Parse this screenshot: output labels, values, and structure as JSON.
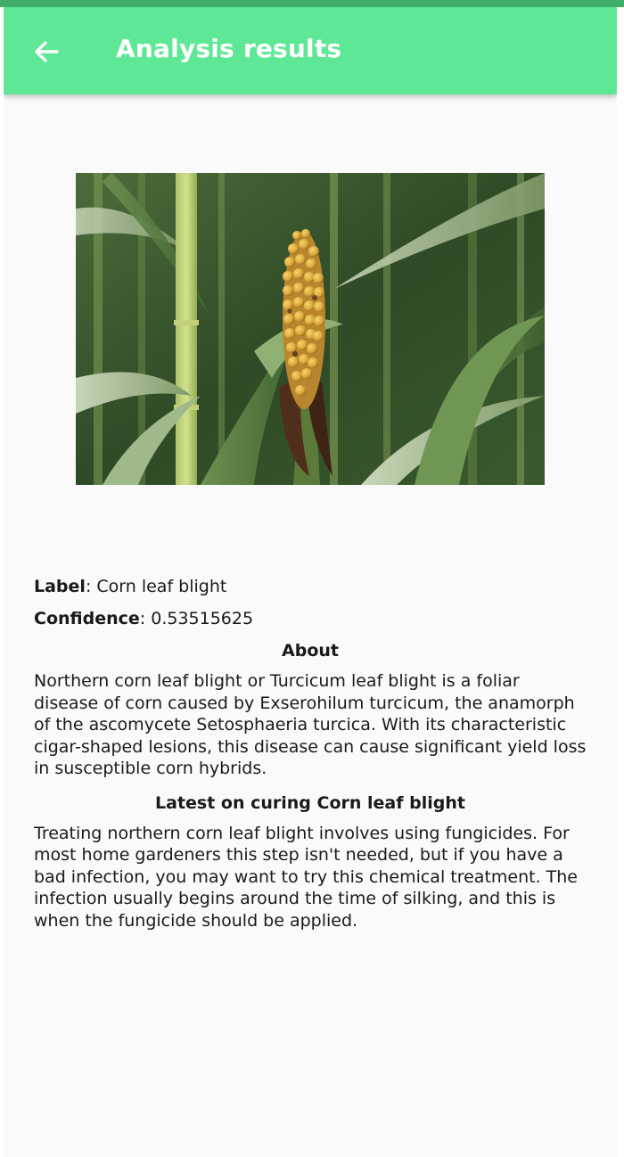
{
  "colors": {
    "status_strip": "#3fae6a",
    "app_bar": "#5ee896",
    "background": "#fafafa",
    "text": "#1a1a1a"
  },
  "app_bar": {
    "back_icon": "arrow-left-icon",
    "title": "Analysis results"
  },
  "image": {
    "subject": "corn-plant-photo"
  },
  "result": {
    "label_key": "Label",
    "label_value": "Corn leaf blight",
    "confidence_key": "Confidence",
    "confidence_value": "0.53515625"
  },
  "about": {
    "heading": "About",
    "text": "Northern corn leaf blight or Turcicum leaf blight is a foliar disease of corn caused by Exserohilum turcicum, the anamorph of the ascomycete Setosphaeria turcica. With its characteristic cigar-shaped lesions, this disease can cause significant yield loss in susceptible corn hybrids."
  },
  "cure": {
    "heading": "Latest on curing Corn leaf blight",
    "text": "Treating northern corn leaf blight involves using fungicides. For most home gardeners this step isn't needed, but if you have a bad infection, you may want to try this chemical treatment. The infection usually begins around the time of silking, and this is when the fungicide should be applied."
  }
}
